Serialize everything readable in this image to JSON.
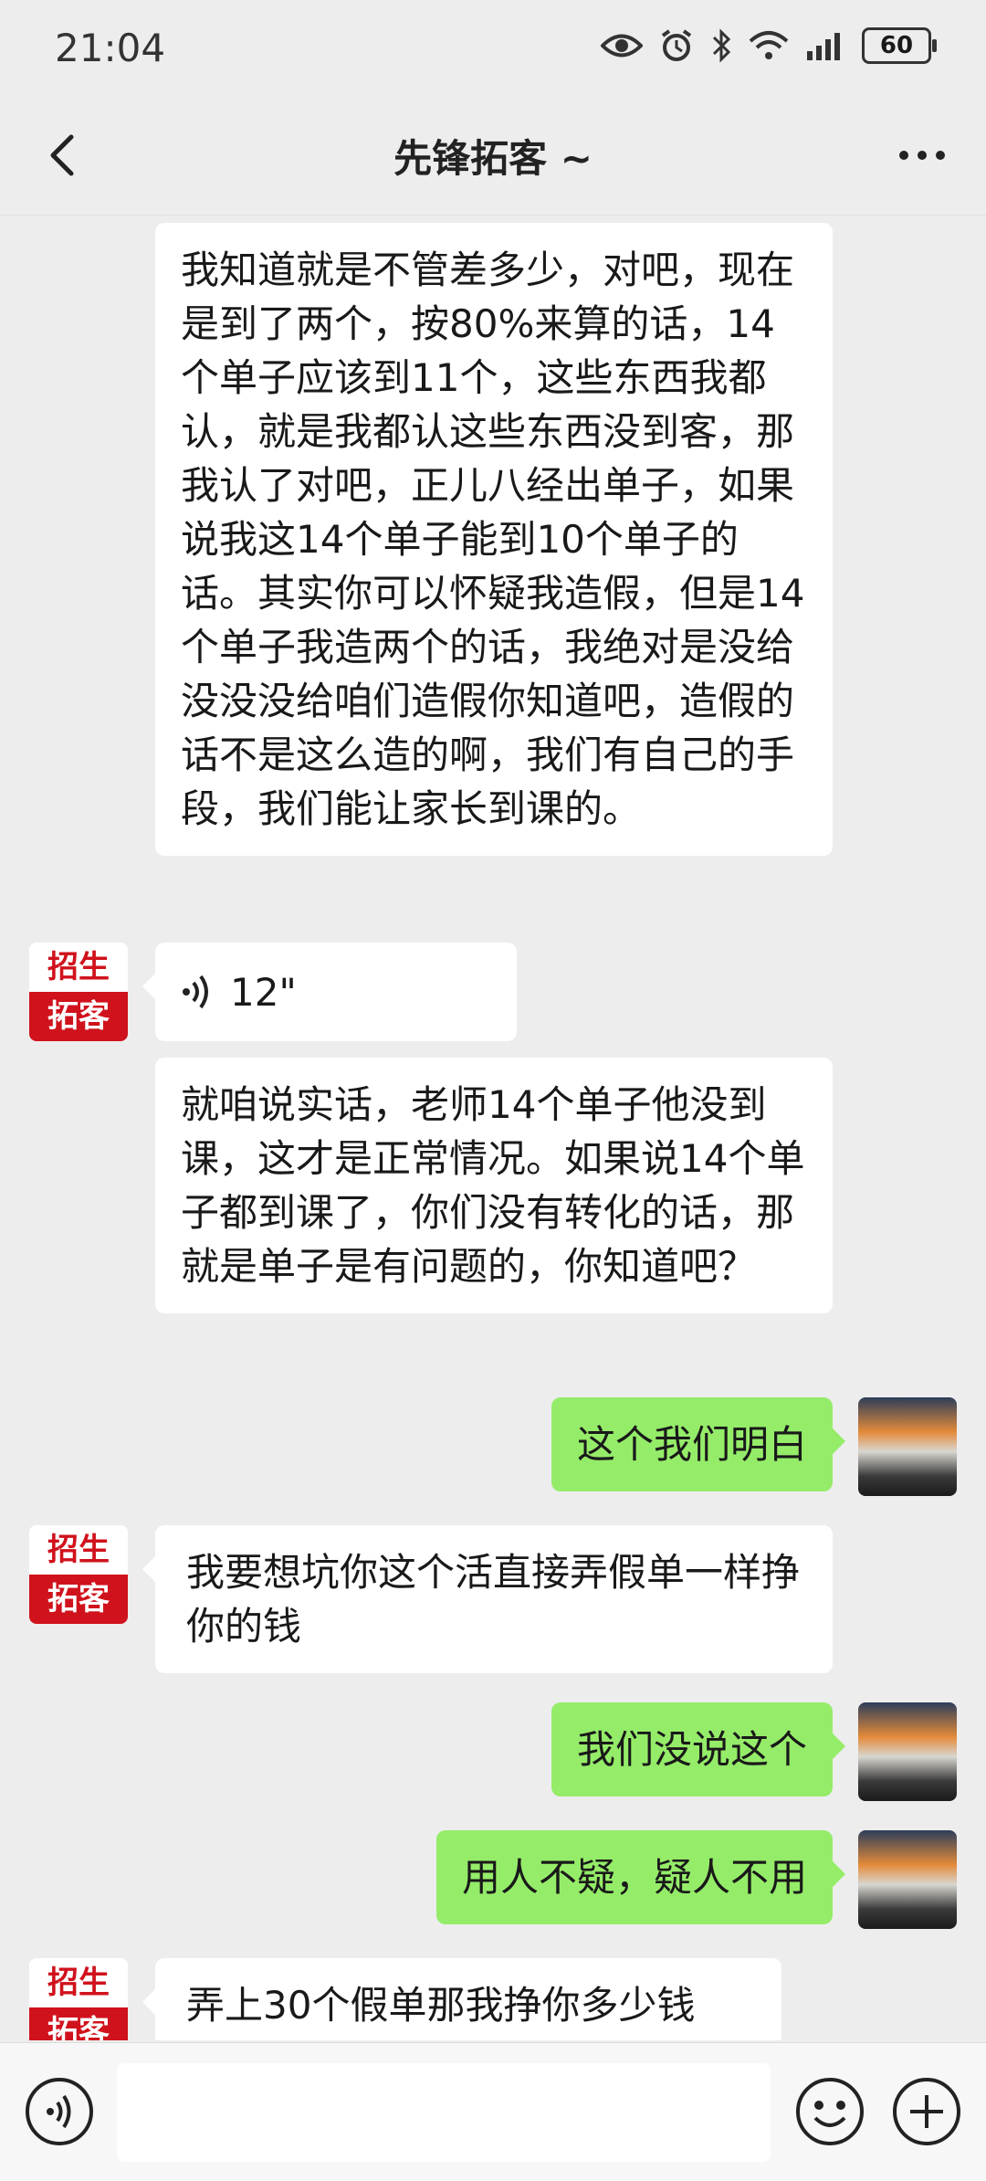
{
  "status_bar": {
    "time": "21:04",
    "battery": "60"
  },
  "header": {
    "title": "先锋拓客 ~"
  },
  "brand_avatar": {
    "line1": "招生",
    "line2": "拓客"
  },
  "messages": [
    {
      "from": "other",
      "text": "我知道就是不管差多少，对吧，现在是到了两个，按80%来算的话，14个单子应该到11个，这些东西我都认，就是我都认这些东西没到客，那我认了对吧，正儿八经出单子，如果说我这14个单子能到10个单子的话。其实你可以怀疑我造假，但是14个单子我造两个的话，我绝对是没给没没没给咱们造假你知道吧，造假的话不是这么造的啊，我们有自己的手段，我们能让家长到课的。"
    },
    {
      "from": "other",
      "type": "voice",
      "duration": "12\""
    },
    {
      "from": "other",
      "text": "就咱说实话，老师14个单子他没到课，这才是正常情况。如果说14个单子都到课了，你们没有转化的话，那就是单子是有问题的，你知道吧？"
    },
    {
      "from": "me",
      "text": "这个我们明白"
    },
    {
      "from": "other",
      "text": "我要想坑你这个活直接弄假单一样挣你的钱"
    },
    {
      "from": "me",
      "text": "我们没说这个"
    },
    {
      "from": "me",
      "text": "用人不疑，疑人不用"
    },
    {
      "from": "other",
      "text": "弄上30个假单那我挣你多少钱"
    }
  ]
}
